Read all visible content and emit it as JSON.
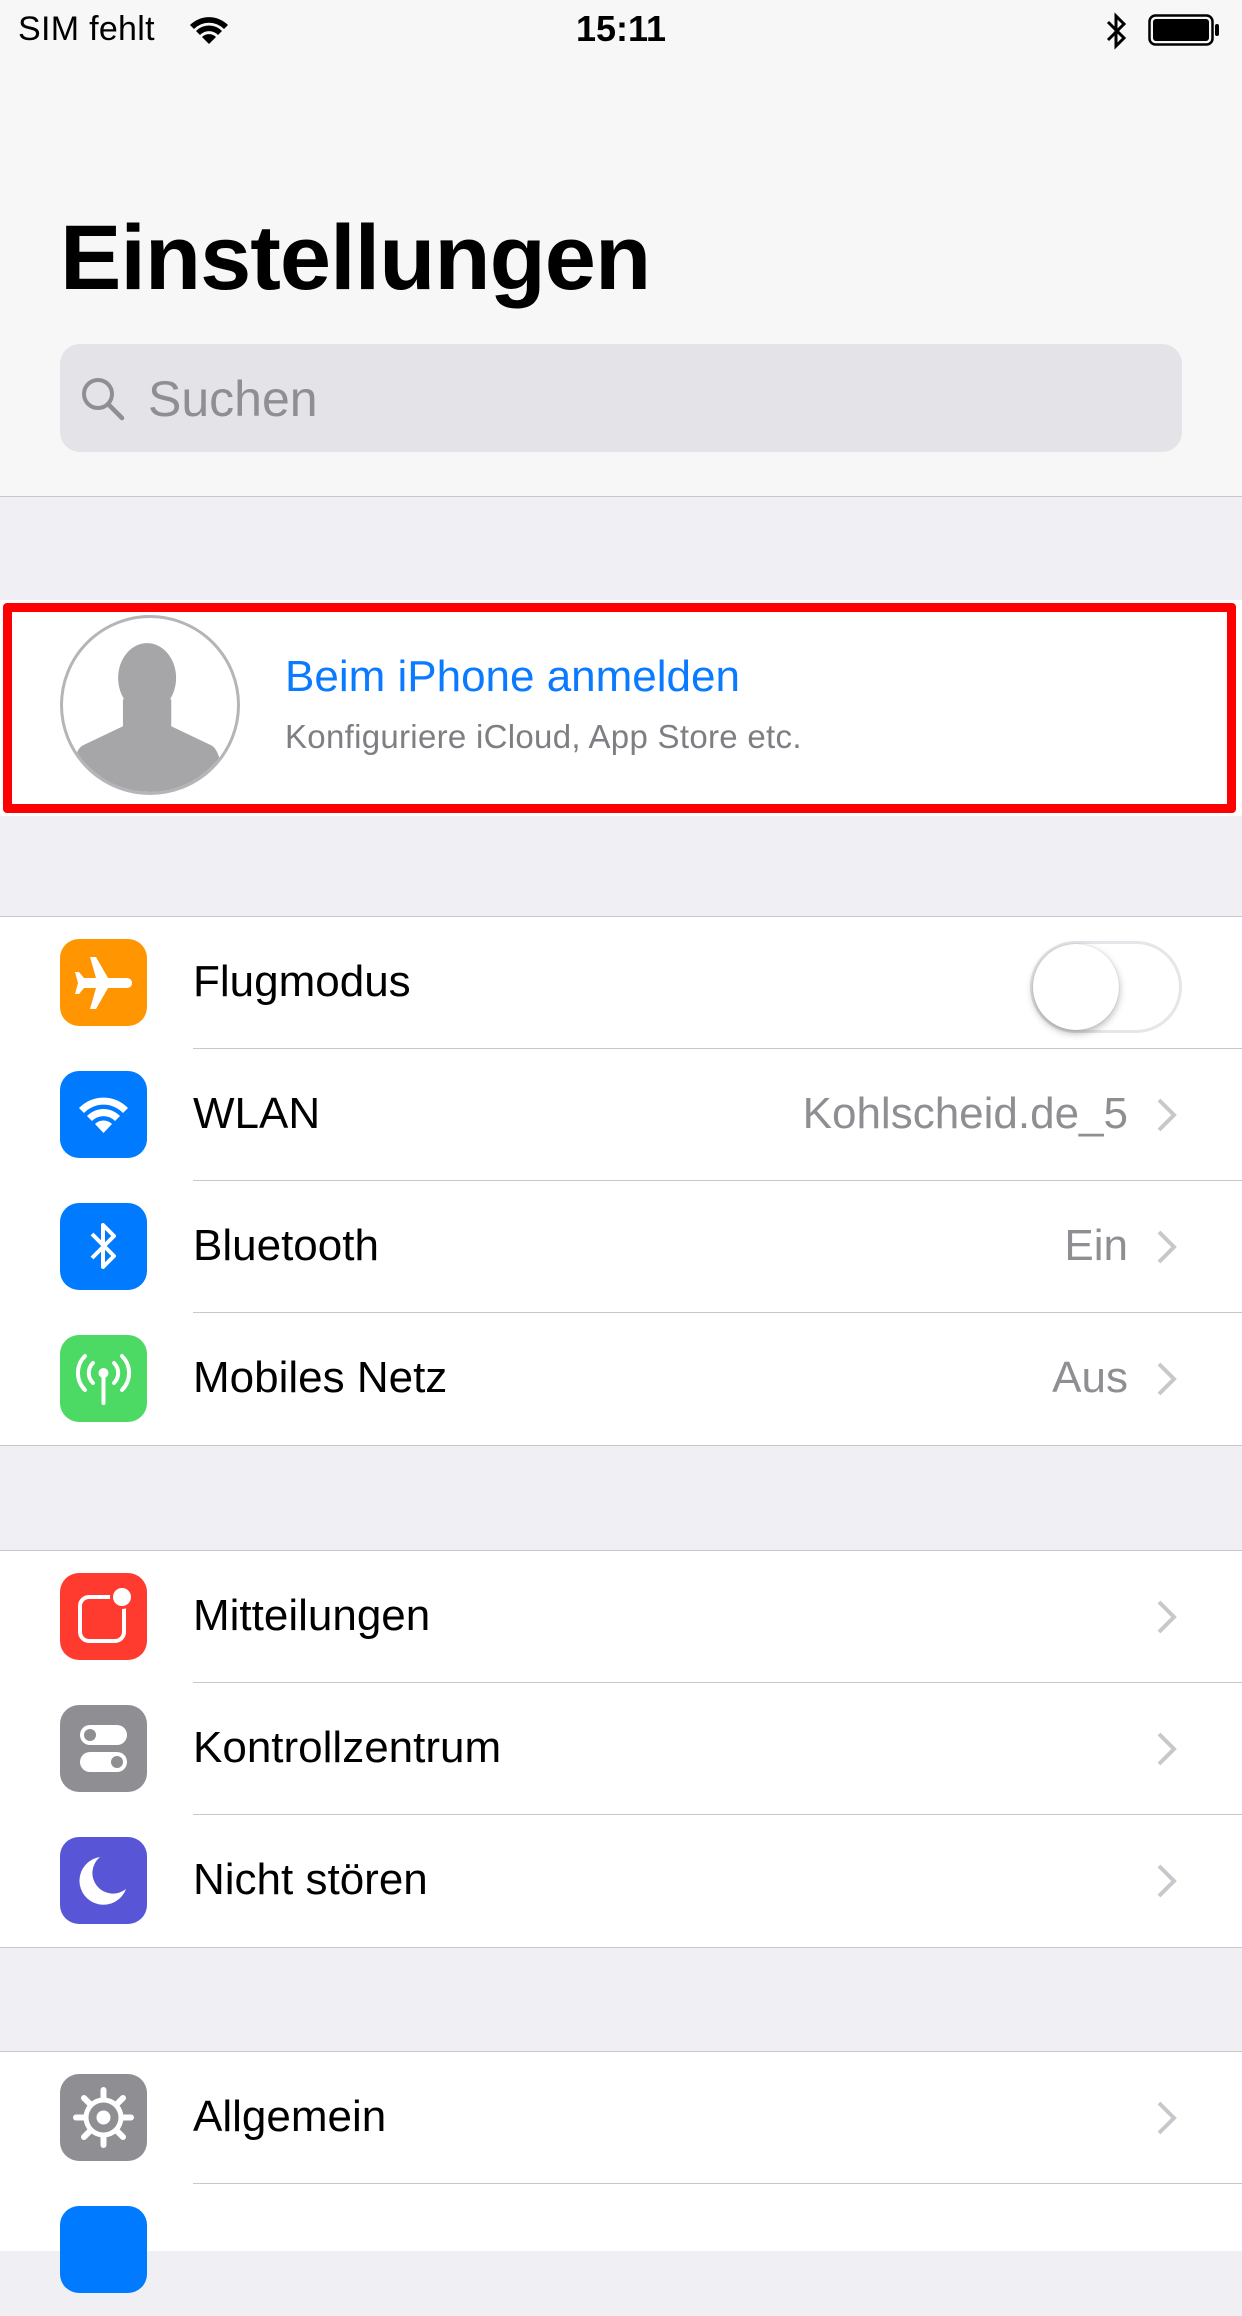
{
  "status_bar": {
    "carrier": "SIM fehlt",
    "time": "15:11"
  },
  "header": {
    "title": "Einstellungen",
    "search_placeholder": "Suchen"
  },
  "profile": {
    "title": "Beim iPhone anmelden",
    "subtitle": "Konfiguriere iCloud, App Store etc."
  },
  "groups": [
    {
      "rows": [
        {
          "icon": "airplane-icon",
          "color": "#ff9500",
          "label": "Flugmodus",
          "toggle": false
        },
        {
          "icon": "wifi-icon",
          "color": "#007aff",
          "label": "WLAN",
          "value": "Kohlscheid.de_5"
        },
        {
          "icon": "bluetooth-icon",
          "color": "#007aff",
          "label": "Bluetooth",
          "value": "Ein"
        },
        {
          "icon": "antenna-icon",
          "color": "#4cd964",
          "label": "Mobiles Netz",
          "value": "Aus"
        }
      ]
    },
    {
      "rows": [
        {
          "icon": "notifications-icon",
          "color": "#ff3b30",
          "label": "Mitteilungen"
        },
        {
          "icon": "control-center-icon",
          "color": "#8e8e93",
          "label": "Kontrollzentrum"
        },
        {
          "icon": "moon-icon",
          "color": "#5856d6",
          "label": "Nicht stören"
        }
      ]
    },
    {
      "rows": [
        {
          "icon": "gear-icon",
          "color": "#8e8e93",
          "label": "Allgemein"
        }
      ]
    }
  ],
  "colors": {
    "accent": "#0a7aff",
    "highlight": "#ff0000"
  }
}
